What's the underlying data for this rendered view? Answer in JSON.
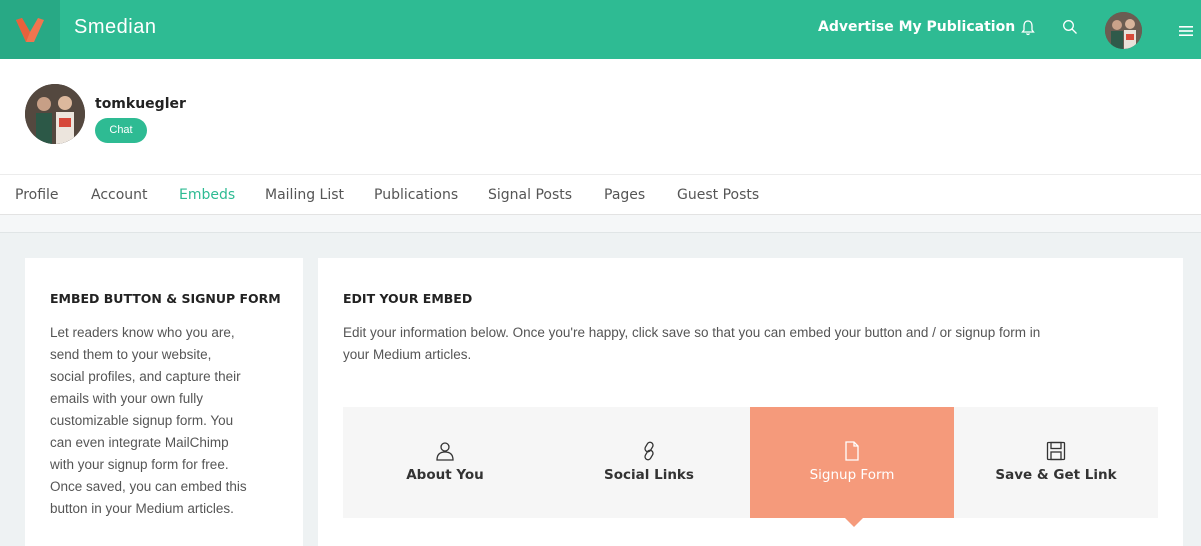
{
  "header": {
    "brand": "Smedian",
    "advertise_label": "Advertise My Publication",
    "icons": [
      "bell-icon",
      "search-icon",
      "user-avatar",
      "menu-icon"
    ]
  },
  "profile": {
    "username": "tomkuegler",
    "chat_label": "Chat"
  },
  "nav": {
    "items": [
      {
        "label": "Profile",
        "active": false
      },
      {
        "label": "Account",
        "active": false
      },
      {
        "label": "Embeds",
        "active": true
      },
      {
        "label": "Mailing List",
        "active": false
      },
      {
        "label": "Publications",
        "active": false
      },
      {
        "label": "Signal Posts",
        "active": false
      },
      {
        "label": "Pages",
        "active": false
      },
      {
        "label": "Guest Posts",
        "active": false
      }
    ]
  },
  "left_card": {
    "heading": "EMBED BUTTON & SIGNUP FORM",
    "lines": [
      "Let readers know who you are,",
      "send them to your website,",
      "social profiles, and capture their",
      "emails with your own fully",
      "customizable signup form. You",
      "can even integrate MailChimp",
      "with your signup form for free.",
      "Once saved, you can embed this",
      "button in your Medium articles."
    ]
  },
  "right_card": {
    "heading": "EDIT YOUR EMBED",
    "lines": [
      "Edit your information below. Once you're happy, click save so that you can embed your button and / or signup form in",
      "your Medium articles."
    ],
    "tabs": [
      {
        "label": "About You",
        "icon": "user-icon",
        "active": false
      },
      {
        "label": "Social Links",
        "icon": "link-icon",
        "active": false
      },
      {
        "label": "Signup Form",
        "icon": "document-icon",
        "active": true
      },
      {
        "label": "Save & Get Link",
        "icon": "save-icon",
        "active": false
      }
    ]
  },
  "colors": {
    "brand_green": "#2ebb93",
    "active_tab": "#f59a7b"
  }
}
